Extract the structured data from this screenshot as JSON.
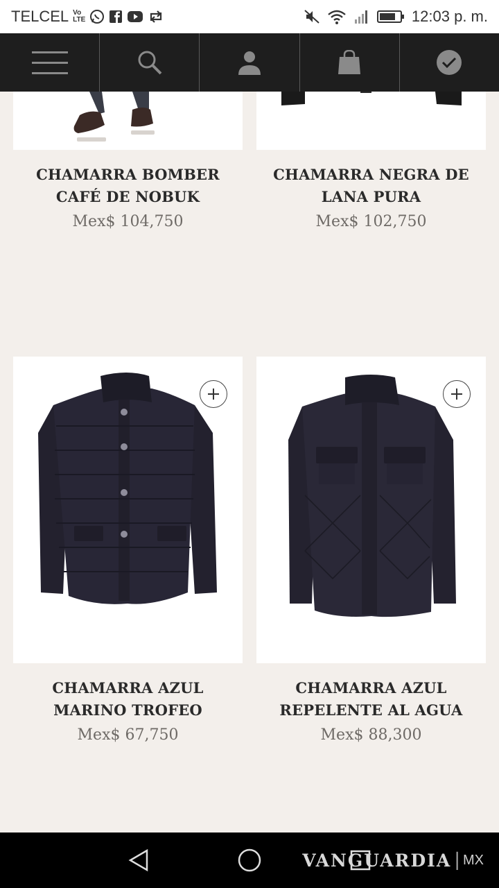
{
  "status_bar": {
    "carrier": "TELCEL",
    "volte_top": "Vo",
    "volte_bottom": "LTE",
    "time": "12:03 p. m."
  },
  "nav_bar": {
    "items": [
      "menu-icon",
      "search-icon",
      "account-icon",
      "shopping-bag-icon",
      "checkmark-icon"
    ]
  },
  "products": [
    {
      "name": "CHAMARRA BOMBER\nCAFÉ DE NOBUK",
      "price": "Mex$ 104,750"
    },
    {
      "name": "CHAMARRA NEGRA DE\nLANA PURA",
      "price": "Mex$ 102,750"
    },
    {
      "name": "CHAMARRA AZUL\nMARINO TROFEO",
      "price": "Mex$ 67,750"
    },
    {
      "name": "CHAMARRA AZUL\nREPELENTE AL AGUA",
      "price": "Mex$ 88,300"
    }
  ],
  "watermark": {
    "brand": "VANGUARDIA",
    "suffix": "MX"
  },
  "colors": {
    "background": "#f3efeb",
    "nav_bar": "#1e1e1e",
    "jacket_navy": "#23212e"
  }
}
